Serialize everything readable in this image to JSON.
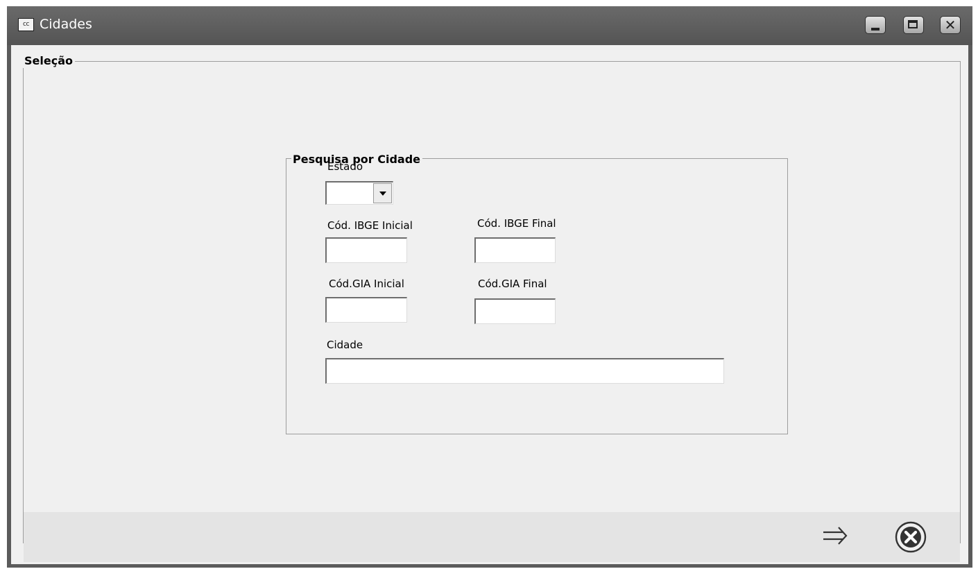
{
  "window": {
    "title": "Cidades",
    "app_icon_text": "cc",
    "controls": {
      "minimize_icon": "minimize-icon",
      "maximize_icon": "maximize-icon",
      "close_icon": "close-icon",
      "close_glyph": "✕"
    }
  },
  "selecao": {
    "legend": "Seleção",
    "pesquisa": {
      "legend": "Pesquisa por Cidade",
      "estado": {
        "label": "Estado",
        "value": ""
      },
      "ibge_inicial": {
        "label": "Cód. IBGE Inicial",
        "value": ""
      },
      "ibge_final": {
        "label": "Cód. IBGE Final",
        "value": ""
      },
      "gia_inicial": {
        "label": "Cód.GIA Inicial",
        "value": ""
      },
      "gia_final": {
        "label": "Cód.GIA Final",
        "value": ""
      },
      "cidade": {
        "label": "Cidade",
        "value": ""
      }
    }
  },
  "actions": {
    "next_icon": "arrow-right-icon",
    "cancel_icon": "cancel-circle-icon"
  },
  "colors": {
    "titlebar": "#5b5b5b",
    "client": "#f0f0f0",
    "bottom_bar": "#e4e4e4"
  }
}
